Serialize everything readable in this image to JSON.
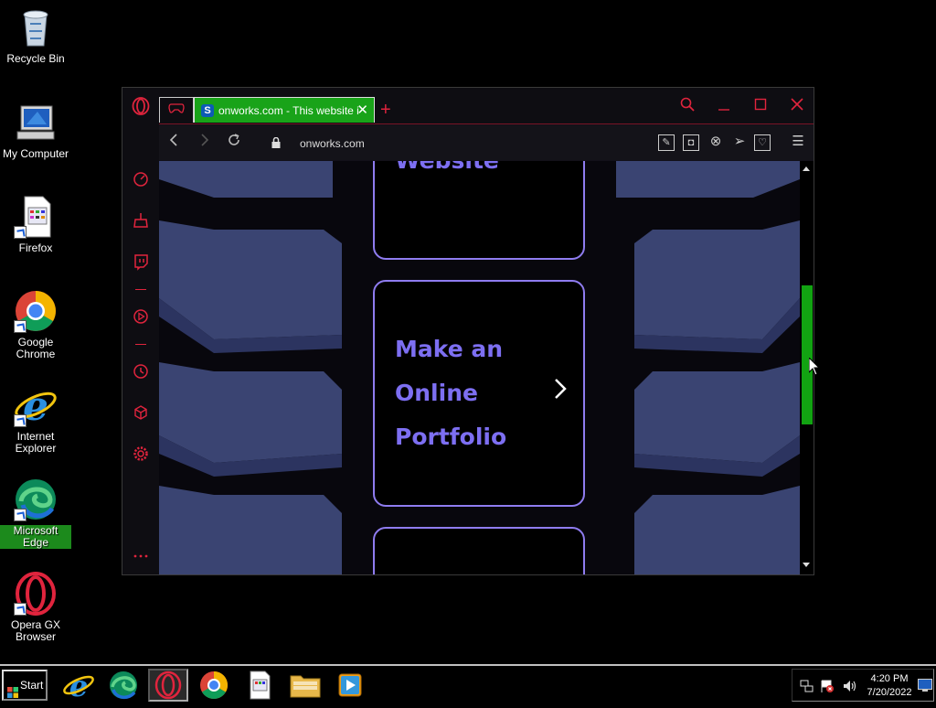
{
  "desktop": {
    "icons": [
      {
        "label": "Recycle Bin"
      },
      {
        "label": "My Computer"
      },
      {
        "label": "Firefox"
      },
      {
        "label": "Google Chrome"
      },
      {
        "label": "Internet Explorer"
      },
      {
        "label": "Microsoft Edge"
      },
      {
        "label": "Opera GX Browser"
      }
    ]
  },
  "browser": {
    "tabs": [
      {
        "title": "onworks.com - This website i",
        "favicon": "S"
      }
    ],
    "new_tab": "+",
    "address": {
      "url": "onworks.com"
    },
    "content": {
      "cards": [
        {
          "text": "Website"
        },
        {
          "text_lines": [
            "Make an",
            "Online",
            "Portfolio"
          ]
        },
        {
          "text": ""
        }
      ]
    }
  },
  "taskbar": {
    "start_label": "Start",
    "clock": {
      "time": "4:20 PM",
      "date": "7/20/2022"
    }
  },
  "colors": {
    "gx_accent": "#e0243d",
    "active_tab": "#19a319",
    "card_text": "#7d6ff2",
    "card_border": "#8f7cf0",
    "scroll_thumb": "#12a312"
  }
}
